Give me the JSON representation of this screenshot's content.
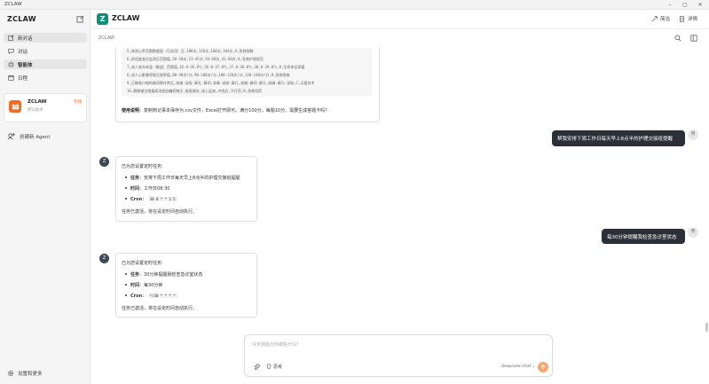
{
  "window": {
    "title": "ZCLAW"
  },
  "sidebar": {
    "brand": "ZCLAW",
    "items": [
      {
        "label": "新对话",
        "icon": "edit-icon"
      },
      {
        "label": "对话",
        "icon": "chat-icon"
      },
      {
        "label": "智能体",
        "icon": "bot-icon"
      },
      {
        "label": "日程",
        "icon": "calendar-icon"
      }
    ],
    "agent": {
      "name": "ZCLAW",
      "subtitle": "默认助手",
      "badge": "在线"
    },
    "create_agent": "创建新 Agent",
    "settings": "设置和更多"
  },
  "header": {
    "title": "ZCLAW",
    "logo_letter": "Z",
    "btn_simple": "简洁",
    "btn_detail": "详情"
  },
  "subheader": {
    "crumb": "ZCLAW"
  },
  "messages": {
    "code_lines": [
      "5,体测心率范围数据值（可选项）至,100次,110次,100次,104次,6,急救指数",
      "6,舒适度变化监测压范围值,20-50次,23-45次,50-60次,41-60次,8,急救护理规范",
      "7,成人老年体温（腋温）范围值,36.0-36.8℃,36.0-37.0℃,37.0-38.0℃,38.0-39.0℃,8,生命体征测量",
      "8,成人心脏骤停按压频率值,80-90次/分,90-100次/分,100-120次/分,120-140次/分,8,急救指南",
      "9,正确吸口咽的鼻饲操作常见,准确-误吸-鼻孔-鼻饲,准确-误吸-鼻孔,准确-鼻饲-鼻孔,准确-鼻孔-误吸,C,无菌技术",
      "10,静脉输注微量高浓度血糖药物注,能直接给,留上层液,冲洗后,不打药,B,急救用药"
    ],
    "usage_label": "使用说明",
    "usage_text": "：复制到记事本保存为.csv文件，Excel打开即可。满分100分，每题10分。需要生成答题卡吗?",
    "user1": "帮我安排下周工作日每天早上8点半的护理交接班提醒",
    "user2": "每30分钟提醒我检查急诊室状态",
    "user_avatar": "用",
    "bot_avatar": "Z",
    "task1": {
      "intro": "已为您设置定时任务:",
      "task_label": "任务",
      "task_value": "：安排下周工作日每天早上8点半的护理交接班提醒",
      "time_label": "时间",
      "time_value": "：工作日08:30",
      "cron_label": "Cron",
      "cron_value": "30 8 * * 1-5",
      "footer": "任务已激活，将在设定时间自动执行。"
    },
    "task2": {
      "intro": "已为您设置定时任务:",
      "task_label": "任务",
      "task_value": "：30分钟提醒我检查急诊室状态",
      "time_label": "时间",
      "time_value": "：每30分钟",
      "cron_label": "Cron",
      "cron_value": "*/30 * * * *",
      "footer": "任务已激活，将在设定时间自动执行。"
    }
  },
  "input": {
    "placeholder": "今天我能为你做些什么？",
    "think_label": "思考",
    "model": "deepseek-chat"
  },
  "colors": {
    "accent": "#f36b2b",
    "logo": "#0e8f7b",
    "user_bubble": "#2b3038"
  }
}
